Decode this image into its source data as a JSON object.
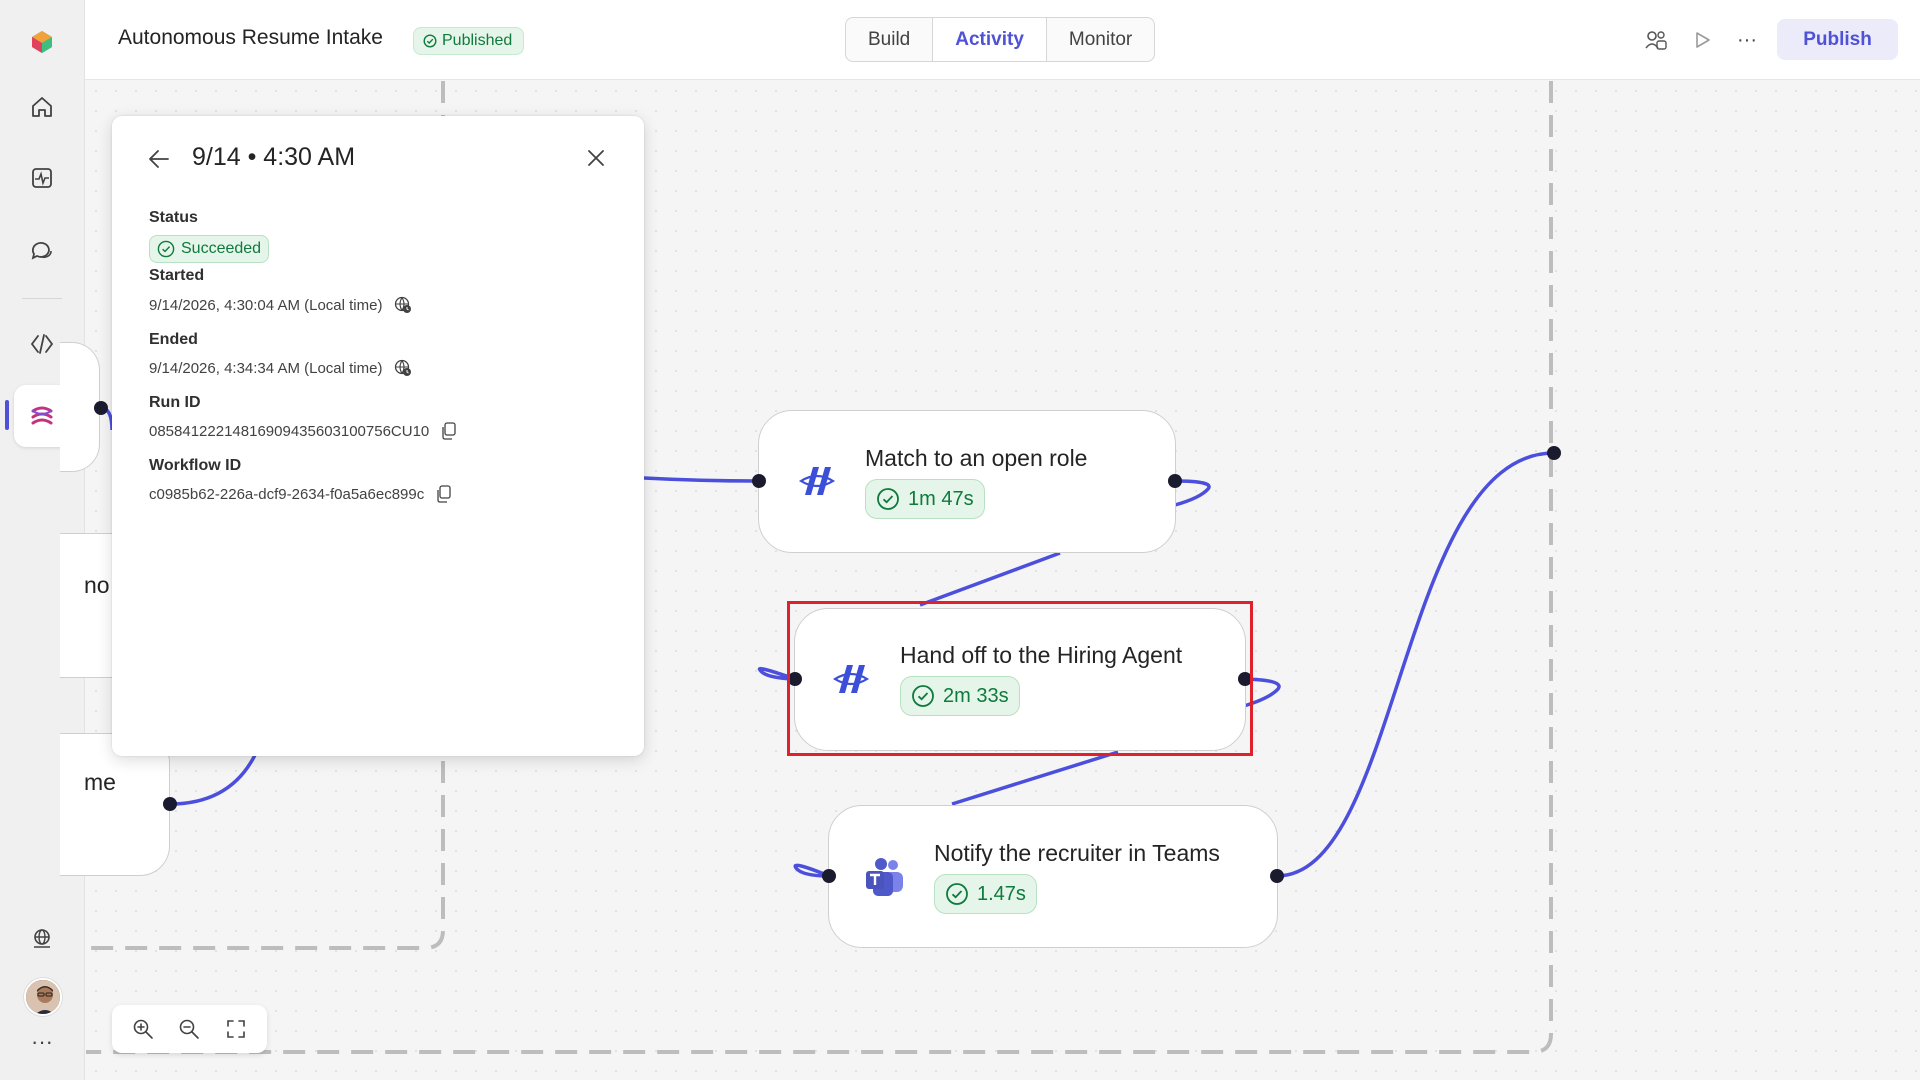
{
  "header": {
    "title": "Autonomous Resume Intake",
    "status_badge": "Published",
    "tabs": [
      {
        "label": "Build",
        "active": false
      },
      {
        "label": "Activity",
        "active": true
      },
      {
        "label": "Monitor",
        "active": false
      }
    ],
    "publish_label": "Publish",
    "more_label": "···"
  },
  "rail": {
    "items": [
      "home-icon",
      "activity-icon",
      "chat-icon",
      "code-icon",
      "workflow-icon"
    ],
    "active": "workflow-icon",
    "more_label": "···"
  },
  "run_panel": {
    "title": "9/14 • 4:30 AM",
    "status_label": "Status",
    "status_value": "Succeeded",
    "started_label": "Started",
    "started_value": "9/14/2026, 4:30:04 AM (Local time)",
    "ended_label": "Ended",
    "ended_value": "9/14/2026, 4:34:34 AM (Local time)",
    "run_id_label": "Run ID",
    "run_id_value": "08584122214816909435603100756CU10",
    "workflow_id_label": "Workflow ID",
    "workflow_id_value": "c0985b62-226a-dcf9-2634-f0a5a6ec899c"
  },
  "nodes": [
    {
      "title": "Match to an open role",
      "duration": "1m 47s",
      "icon": "agent-icon",
      "selected": false
    },
    {
      "title": "Hand off to the Hiring Agent",
      "duration": "2m 33s",
      "icon": "agent-icon",
      "selected": true
    },
    {
      "title": "Notify the recruiter in Teams",
      "duration": "1.47s",
      "icon": "teams-icon",
      "selected": false
    }
  ],
  "partial_nodes": [
    "no",
    "me"
  ],
  "colors": {
    "accent": "#4f52d6",
    "success_bg": "#e6f5ea",
    "success_text": "#0e7a3c",
    "wire": "#4b4fdc",
    "selection": "#e0202a"
  }
}
